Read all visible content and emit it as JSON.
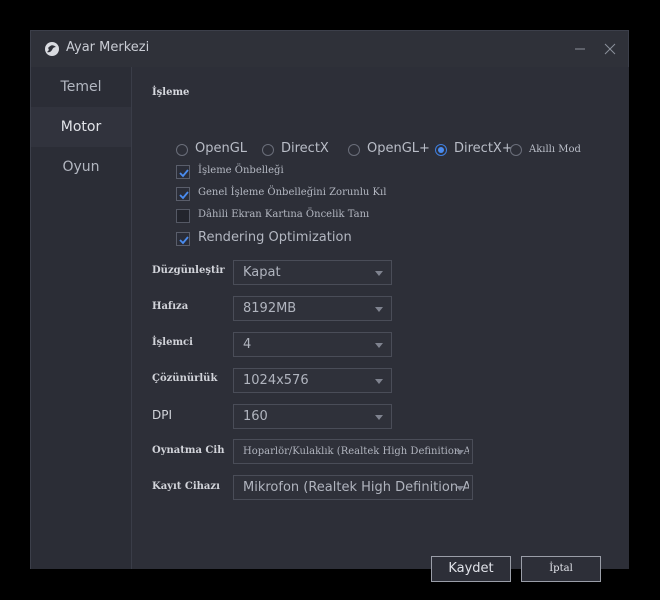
{
  "window": {
    "title": "Ayar Merkezi"
  },
  "sidebar": {
    "items": [
      {
        "label": "Temel",
        "active": false
      },
      {
        "label": "Motor",
        "active": true
      },
      {
        "label": "Oyun",
        "active": false
      }
    ]
  },
  "rendering": {
    "title": "İşleme",
    "modes": [
      {
        "label": "OpenGL",
        "selected": false
      },
      {
        "label": "DirectX",
        "selected": false
      },
      {
        "label": "OpenGL+",
        "selected": false
      },
      {
        "label": "DirectX+",
        "selected": true
      },
      {
        "label": "Akıllı Mod",
        "selected": false
      }
    ],
    "options": [
      {
        "label": "İşleme Önbelleği",
        "checked": true
      },
      {
        "label": "Genel İşleme Önbelleğini Zorunlu Kıl",
        "checked": true
      },
      {
        "label": "Dâhili Ekran Kartına Öncelik Tanı",
        "checked": false
      },
      {
        "label": "Rendering Optimization",
        "checked": true
      }
    ]
  },
  "fields": {
    "smoothing": {
      "label": "Düzgünleştir",
      "value": "Kapat"
    },
    "memory": {
      "label": "Hafıza",
      "value": "8192MB"
    },
    "cpu": {
      "label": "İşlemci",
      "value": "4"
    },
    "resolution": {
      "label": "Çözünürlük",
      "value": "1024x576"
    },
    "dpi": {
      "label": "DPI",
      "value": "160"
    },
    "playback": {
      "label": "Oynatma Cih",
      "value": "Hoparlör/Kulaklık (Realtek High Definition Audio)"
    },
    "recording": {
      "label": "Kayıt Cihazı",
      "value": "Mikrofon (Realtek High Definition Audio)"
    }
  },
  "actions": {
    "save": "Kaydet",
    "cancel": "İptal"
  },
  "colors": {
    "accent": "#4a8cf0",
    "background": "#2d2f38",
    "sidebar_active": "#31333d"
  }
}
